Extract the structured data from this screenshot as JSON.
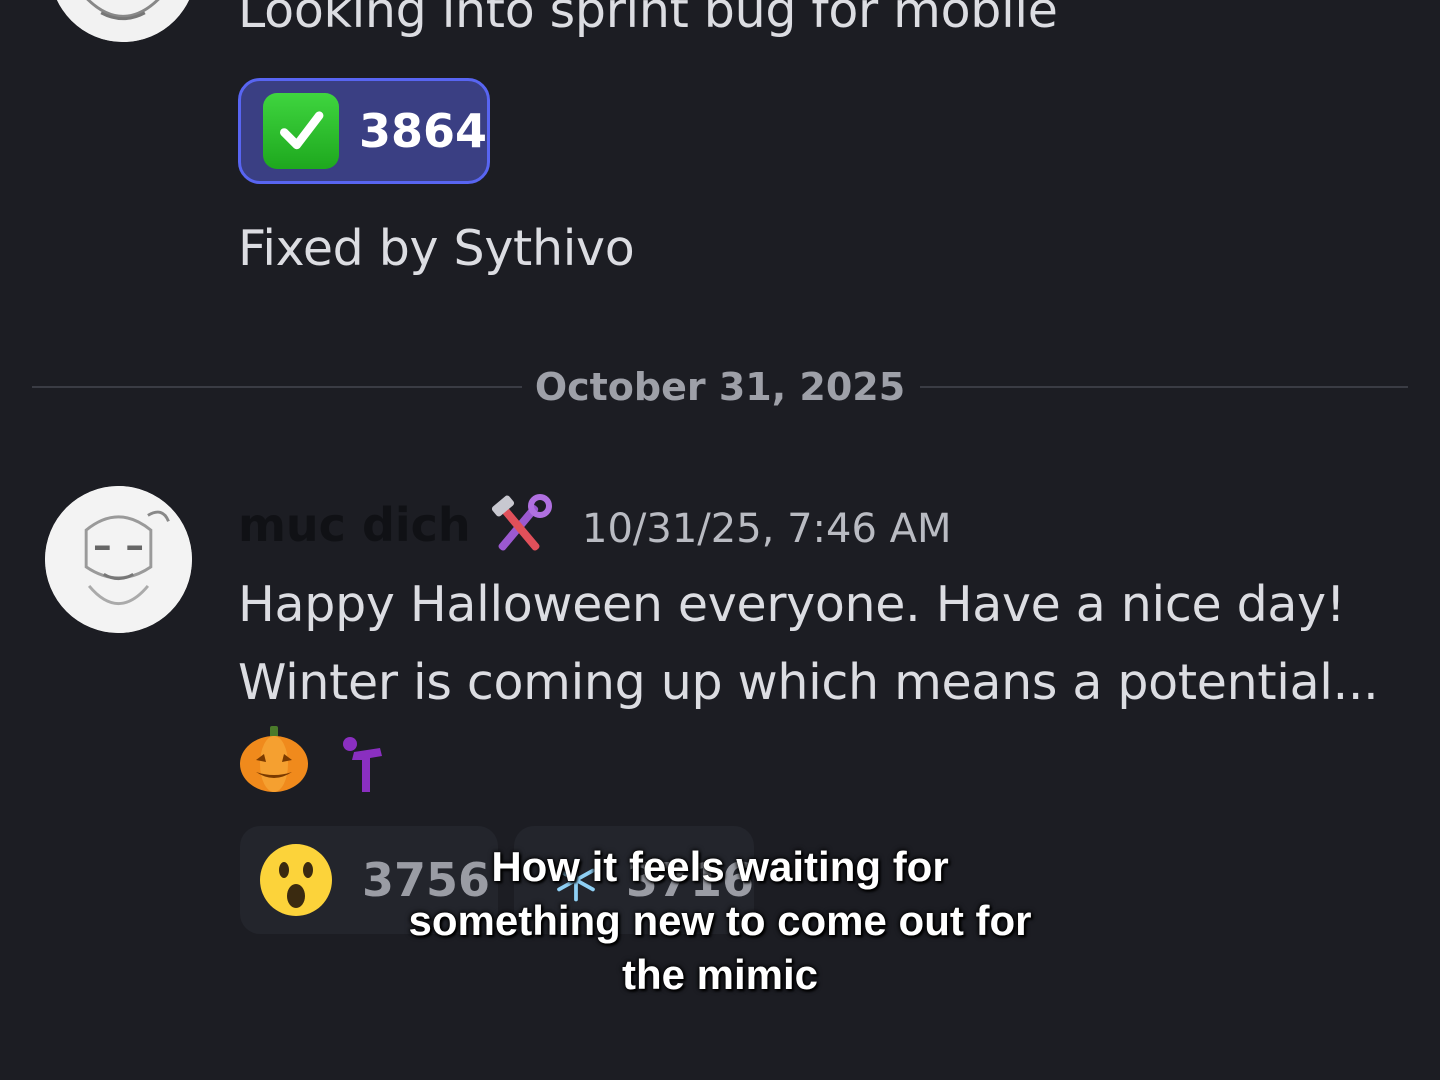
{
  "messages": {
    "top": {
      "text": "Looking into sprint bug for mobile",
      "reaction": {
        "emoji": "check-mark-emoji",
        "count": "3864"
      },
      "fixed_note": "Fixed by Sythivo"
    },
    "main": {
      "username": "muc dich",
      "role_icon": "hammer-wrench-icon",
      "timestamp": "10/31/25, 7:46 AM",
      "line1": "Happy Halloween everyone. Have a nice day!",
      "line2": "Winter is coming up which means a potential...",
      "inline_emojis": [
        "pumpkin-emoji",
        "purple-figure-emoji"
      ],
      "reactions": [
        {
          "emoji": "astonished-face-emoji",
          "count": "3756"
        },
        {
          "emoji": "snowflake-emoji",
          "count": "3716"
        }
      ]
    }
  },
  "date_divider": "October 31, 2025",
  "caption": "How it feels waiting for something new to come out for the mimic",
  "colors": {
    "background": "#1c1d23",
    "active_reaction_bg": "#3a3f83",
    "active_reaction_border": "#5865f2",
    "reaction_bg": "#23252c"
  }
}
